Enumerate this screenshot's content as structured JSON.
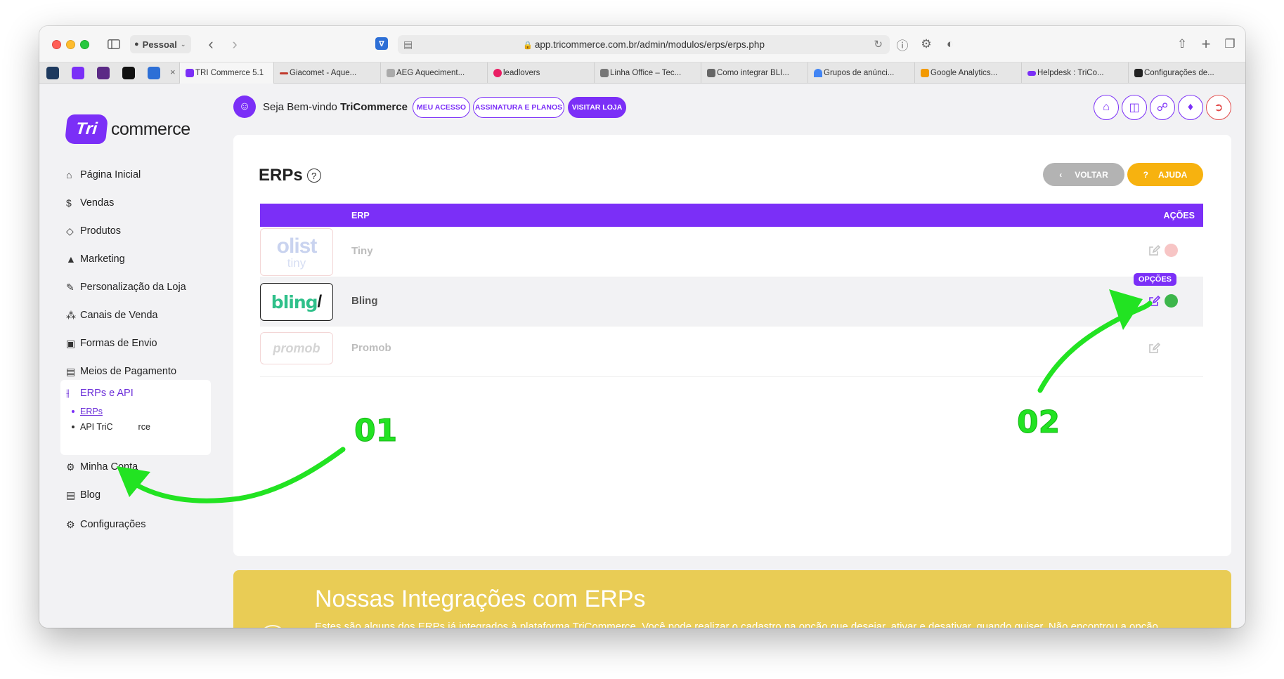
{
  "browser": {
    "profile": "Pessoal",
    "url": "app.tricommerce.com.br/admin/modulos/erps/erps.php",
    "tabs": [
      {
        "label": "TRI Commerce 5.1",
        "color": "#7b2ff7"
      },
      {
        "label": "Giacomet - Aque...",
        "color": "#c0392b"
      },
      {
        "label": "AEG Aqueciment...",
        "color": "#888888"
      },
      {
        "label": "leadlovers",
        "color": "#e91e63"
      },
      {
        "label": "Linha Office – Tec...",
        "color": "#777777"
      },
      {
        "label": "Como integrar BLI...",
        "color": "#666666"
      },
      {
        "label": "Grupos de anúnci...",
        "color": "#4285f4"
      },
      {
        "label": "Google Analytics...",
        "color": "#f29900"
      },
      {
        "label": "Helpdesk : TriCo...",
        "color": "#7b2ff7"
      },
      {
        "label": "Configurações de...",
        "color": "#222222"
      }
    ]
  },
  "logo": {
    "mark": "Tri",
    "text": "commerce"
  },
  "header": {
    "welcome_prefix": "Seja Bem-vindo ",
    "welcome_name": "TriCommerce",
    "buttons": {
      "meu_acesso": "MEU ACESSO",
      "assinatura": "ASSINATURA E PLANOS",
      "visitar_loja": "VISITAR LOJA"
    }
  },
  "sidebar": {
    "items": [
      {
        "label": "Página Inicial",
        "icon": "home-icon"
      },
      {
        "label": "Vendas",
        "icon": "dollar-icon"
      },
      {
        "label": "Produtos",
        "icon": "tag-icon"
      },
      {
        "label": "Marketing",
        "icon": "megaphone-icon"
      },
      {
        "label": "Personalização da Loja",
        "icon": "brush-icon"
      },
      {
        "label": "Canais de Venda",
        "icon": "network-icon"
      },
      {
        "label": "Formas de Envio",
        "icon": "truck-icon"
      },
      {
        "label": "Meios de Pagamento",
        "icon": "wallet-icon"
      },
      {
        "label": "ERPs e API",
        "icon": "share-icon"
      },
      {
        "label": "Minha Conta",
        "icon": "gear-icon"
      },
      {
        "label": "Blog",
        "icon": "document-icon"
      },
      {
        "label": "Configurações",
        "icon": "gear-icon"
      }
    ],
    "subitems": [
      {
        "label": "ERPs"
      },
      {
        "label": "API TriC"
      },
      {
        "label": "rce"
      }
    ]
  },
  "main": {
    "title": "ERPs",
    "voltar": "VOLTAR",
    "ajuda": "AJUDA",
    "ajuda_icon": "?",
    "table": {
      "columns": [
        "ERP",
        "AÇÕES"
      ],
      "rows": [
        {
          "logo_main": "olist",
          "logo_sub": "tiny",
          "name": "Tiny",
          "status_color": "#f7c5c5"
        },
        {
          "logo_main": "bling",
          "logo_mark": "/",
          "name": "Bling",
          "status_color": "#3db64b",
          "tooltip": "OPÇÕES"
        },
        {
          "logo_main": "promob",
          "name": "Promob"
        }
      ]
    }
  },
  "banner": {
    "title": "Nossas Integrações com ERPs",
    "text": "Estes são alguns dos ERPs já integrados à plataforma TriCommerce. Você pode realizar o cadastro na opção que desejar, ativar e desativar, quando quiser. Não encontrou a opção"
  },
  "annotations": {
    "label_1": "01",
    "label_2": "02",
    "color": "#22e322"
  }
}
